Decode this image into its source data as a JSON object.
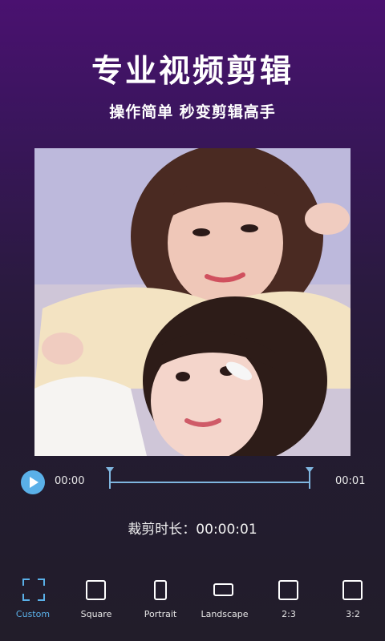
{
  "promo": {
    "headline": "专业视频剪辑",
    "subline": "操作简单  秒变剪辑高手"
  },
  "player": {
    "current_time": "00:00",
    "end_time": "00:01",
    "play_icon": "play-icon",
    "accent_color": "#5ab0e8"
  },
  "trim": {
    "duration_text": "裁剪时长：00:00:01"
  },
  "ratio_options": [
    {
      "label": "Custom",
      "icon": "crop-corners-icon",
      "active": true
    },
    {
      "label": "Square",
      "icon": "square-icon",
      "active": false
    },
    {
      "label": "Portrait",
      "icon": "portrait-rect-icon",
      "active": false
    },
    {
      "label": "Landscape",
      "icon": "landscape-rect-icon",
      "active": false
    },
    {
      "label": "2:3",
      "icon": "square-icon",
      "active": false
    },
    {
      "label": "3:2",
      "icon": "square-icon",
      "active": false
    }
  ]
}
